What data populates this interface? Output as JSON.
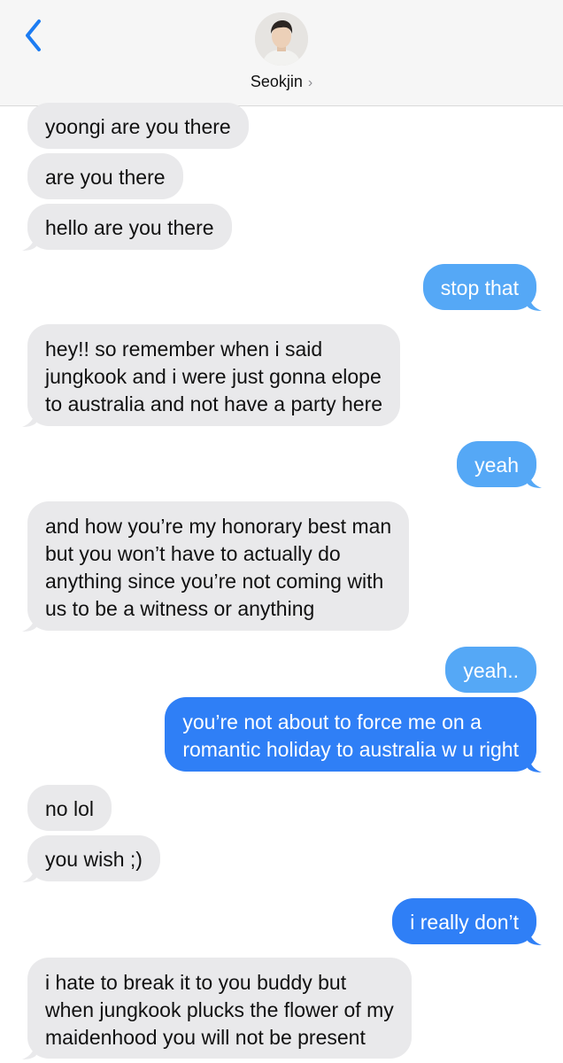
{
  "header": {
    "contact_name": "Seokjin",
    "chevron": "›"
  },
  "messages": [
    {
      "type": "received",
      "text": "yoongi are you there"
    },
    {
      "type": "received",
      "text": "are you there"
    },
    {
      "type": "received",
      "text": "hello are you there"
    },
    {
      "type": "sent",
      "text": "stop that"
    },
    {
      "type": "received",
      "text": "hey!! so remember when i said\njungkook and i were just gonna elope\nto australia and not have a party here"
    },
    {
      "type": "sent",
      "text": "yeah"
    },
    {
      "type": "received",
      "text": "and how you’re my honorary best man\nbut you won’t have to actually do\nanything since you’re not coming with\nus to be a witness or anything"
    },
    {
      "type": "sent",
      "text": "yeah.."
    },
    {
      "type": "sent",
      "text": "you’re not about to force me on a\nromantic holiday to australia w u right"
    },
    {
      "type": "received",
      "text": "no lol"
    },
    {
      "type": "received",
      "text": "you wish ;)"
    },
    {
      "type": "sent",
      "text": "i really don’t"
    },
    {
      "type": "received",
      "text": "i hate to break it to you buddy but\nwhen jungkook plucks the flower of my\nmaidenhood you will not be present"
    }
  ],
  "colors": {
    "received_bubble": "#e9e9eb",
    "sent_bubble_light": "#55a8f6",
    "sent_bubble_dark": "#2f7ff6",
    "ios_blue": "#1c7cf2"
  },
  "icons": {
    "back": "chevron-left-icon",
    "contact_chevron": "chevron-right-icon"
  }
}
